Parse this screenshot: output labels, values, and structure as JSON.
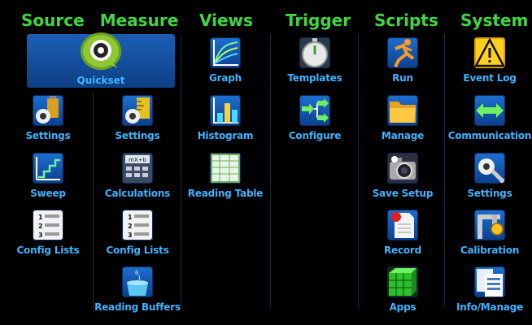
{
  "headers": {
    "source": "Source",
    "measure": "Measure",
    "views": "Views",
    "trigger": "Trigger",
    "scripts": "Scripts",
    "system": "System"
  },
  "source": {
    "quickset": "Quickset",
    "settings": "Settings",
    "sweep": "Sweep",
    "config_lists": "Config Lists"
  },
  "measure": {
    "settings": "Settings",
    "calculations": "Calculations",
    "config_lists": "Config Lists",
    "reading_buffers": "Reading Buffers"
  },
  "views": {
    "graph": "Graph",
    "histogram": "Histogram",
    "reading_table": "Reading Table"
  },
  "trigger": {
    "templates": "Templates",
    "configure": "Configure"
  },
  "scripts": {
    "run": "Run",
    "manage": "Manage",
    "save_setup": "Save Setup",
    "record": "Record",
    "apps": "Apps"
  },
  "system": {
    "event_log": "Event Log",
    "communication": "Communication",
    "settings": "Settings",
    "calibration": "Calibration",
    "info_manage": "Info/Manage"
  },
  "icon_text": {
    "calc": "mX+b",
    "list_1": "1",
    "list_2": "2",
    "list_3": "3"
  },
  "colors": {
    "header": "#3ed83e",
    "label": "#3fb3ff",
    "tile_top": "#1d6fcf",
    "tile_bottom": "#0b3f8e",
    "background": "#000000"
  }
}
